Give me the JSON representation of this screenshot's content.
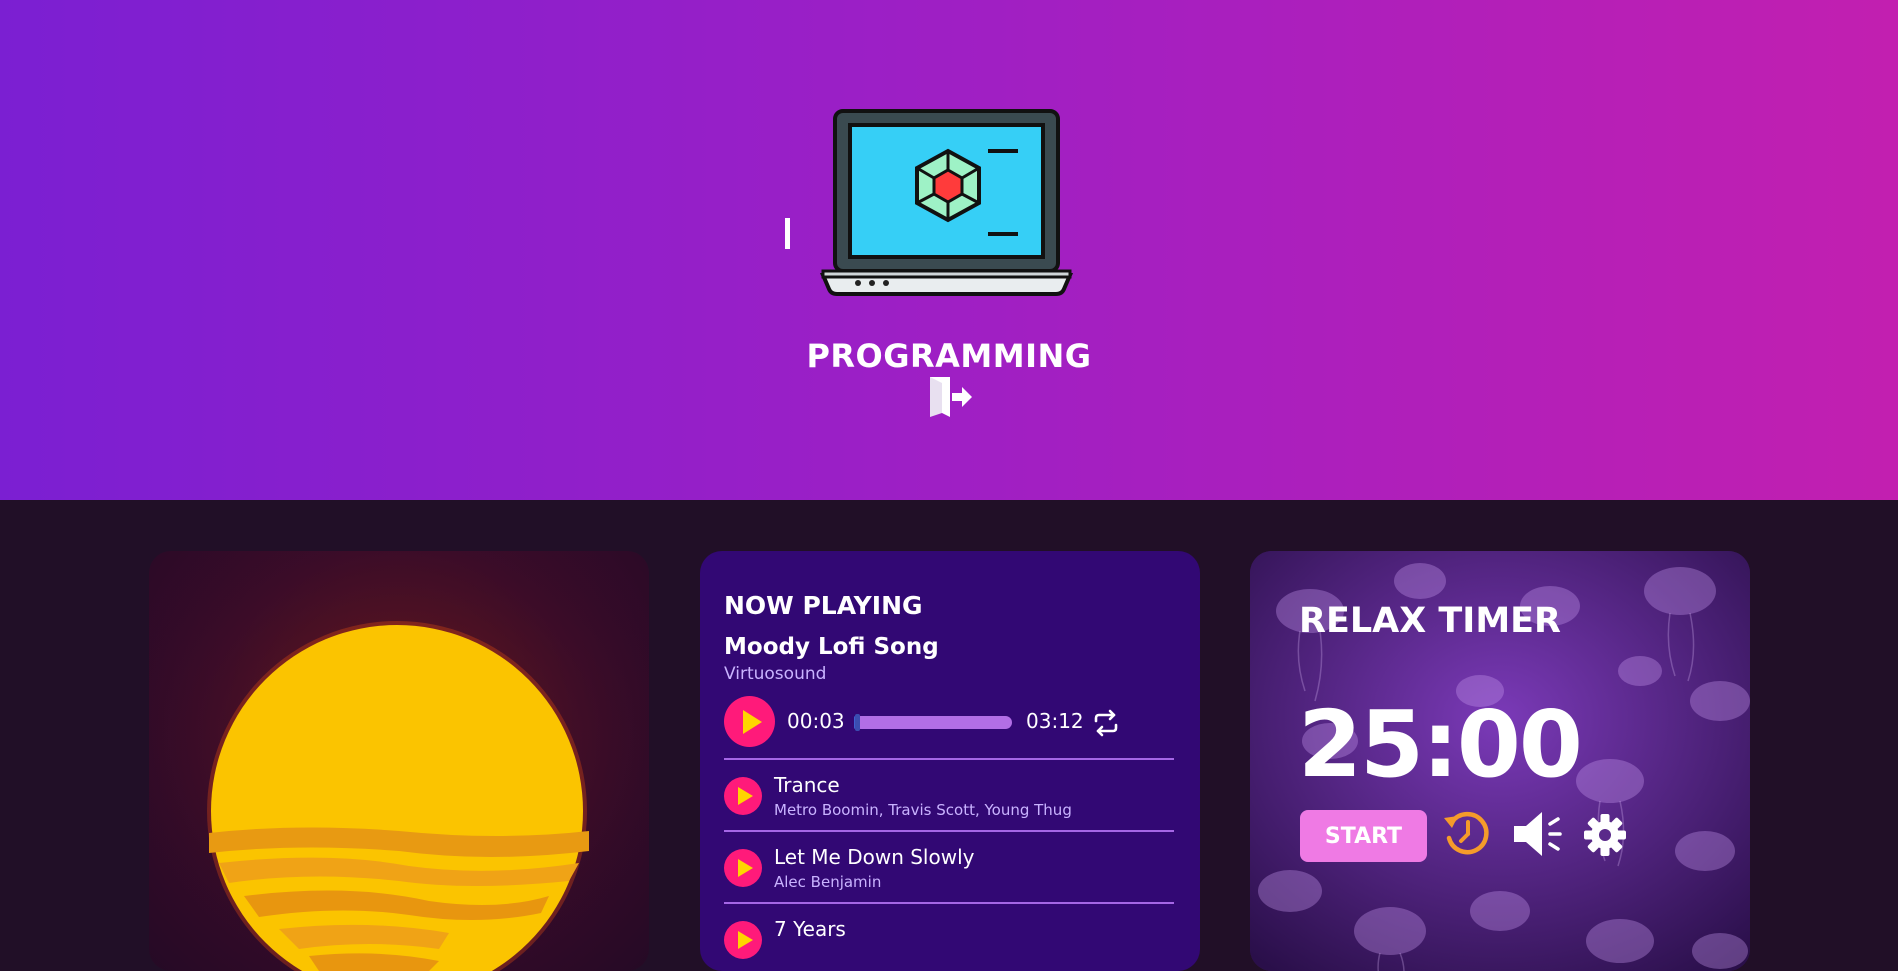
{
  "hero": {
    "title": "PROGRAMMING"
  },
  "player": {
    "heading": "NOW PLAYING",
    "song_title": "Moody Lofi Song",
    "song_artist": "Virtuosound",
    "time_current": "00:03",
    "time_total": "03:12",
    "progress_fraction": 0.016,
    "tracks": [
      {
        "name": "Trance",
        "artists": "Metro Boomin, Travis Scott, Young Thug"
      },
      {
        "name": "Let Me Down Slowly",
        "artists": "Alec Benjamin"
      },
      {
        "name": "7 Years",
        "artists": ""
      }
    ]
  },
  "timer": {
    "heading": "RELAX TIMER",
    "value": "25:00",
    "start_label": "START"
  },
  "icons": {
    "laptop": "laptop-icon",
    "exit": "exit-door-icon",
    "repeat": "repeat-icon",
    "reset": "reset-timer-icon",
    "volume": "volume-icon",
    "settings": "gear-icon"
  },
  "colors": {
    "hero_gradient_start": "#7b1fd2",
    "hero_gradient_end": "#c21fb0",
    "page_background": "#210f27",
    "player_card": "#320874",
    "accent_play": "#ff1a7a",
    "play_triangle": "#ffd500",
    "start_button": "#ef7ae4",
    "reset_icon": "#f59b2a"
  }
}
